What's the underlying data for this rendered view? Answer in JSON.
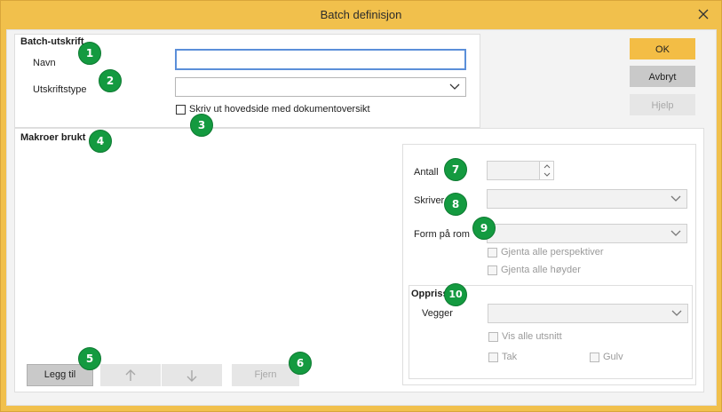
{
  "window": {
    "title": "Batch definisjon"
  },
  "batch": {
    "group_title": "Batch-utskrift",
    "name_label": "Navn",
    "name_value": "",
    "type_label": "Utskriftstype",
    "type_value": "",
    "print_main_label": "Skriv ut hovedside med dokumentoversikt"
  },
  "macros": {
    "group_title": "Makroer brukt"
  },
  "buttons": {
    "ok": "OK",
    "cancel": "Avbryt",
    "help": "Hjelp",
    "add": "Legg til",
    "remove": "Fjern"
  },
  "settings": {
    "count_label": "Antall",
    "count_value": "",
    "printer_label": "Skriver",
    "printer_value": "",
    "room_shape_label": "Form på rom",
    "room_shape_value": "",
    "repeat_perspectives": "Gjenta alle perspektiver",
    "repeat_heights": "Gjenta alle høyder"
  },
  "elevation": {
    "group_title": "Oppriss",
    "walls_label": "Vegger",
    "walls_value": "",
    "show_all_cuts": "Vis alle utsnitt",
    "ceiling": "Tak",
    "floor": "Gulv"
  },
  "badges": [
    "1",
    "2",
    "3",
    "4",
    "5",
    "6",
    "7",
    "8",
    "9",
    "10"
  ],
  "colors": {
    "titlebar": "#f1c04c",
    "ok_button": "#f3bd45",
    "badge": "#149a40",
    "focus_border": "#5b8fd9"
  }
}
